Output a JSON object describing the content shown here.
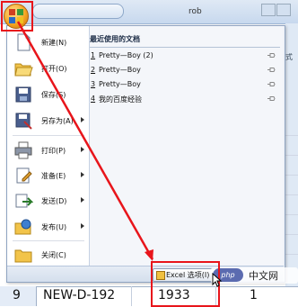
{
  "title_fragment": "rob",
  "right_fragment_1": "式",
  "right_fragment_2": "",
  "menu_items": [
    {
      "label": "新建(N)",
      "icon": "new-document-icon",
      "has_submenu": false
    },
    {
      "label": "打开(O)",
      "icon": "open-folder-icon",
      "has_submenu": false
    },
    {
      "label": "保存(S)",
      "icon": "save-icon",
      "has_submenu": false
    },
    {
      "label": "另存为(A)",
      "icon": "save-as-icon",
      "has_submenu": true
    },
    {
      "label": "打印(P)",
      "icon": "print-icon",
      "has_submenu": true
    },
    {
      "label": "准备(E)",
      "icon": "prepare-icon",
      "has_submenu": true
    },
    {
      "label": "发送(D)",
      "icon": "send-icon",
      "has_submenu": true
    },
    {
      "label": "发布(U)",
      "icon": "publish-icon",
      "has_submenu": true
    },
    {
      "label": "关闭(C)",
      "icon": "close-folder-icon",
      "has_submenu": false
    }
  ],
  "recent": {
    "header": "最近使用的文档",
    "items": [
      {
        "num": "1",
        "name": "Pretty—Boy (2)"
      },
      {
        "num": "2",
        "name": "Pretty—Boy"
      },
      {
        "num": "3",
        "name": "Pretty—Boy"
      },
      {
        "num": "4",
        "name": "我的百度经验"
      }
    ]
  },
  "options_button": {
    "label": "Excel 选项(I)"
  },
  "watermark": {
    "brand": "php",
    "text": "中文网"
  },
  "sheet_row": {
    "row_number": "9",
    "cells": [
      "NEW-D-192",
      "1933",
      "1"
    ]
  },
  "colors": {
    "annotation": "#e8151b",
    "office_orb": "#f5a623"
  }
}
